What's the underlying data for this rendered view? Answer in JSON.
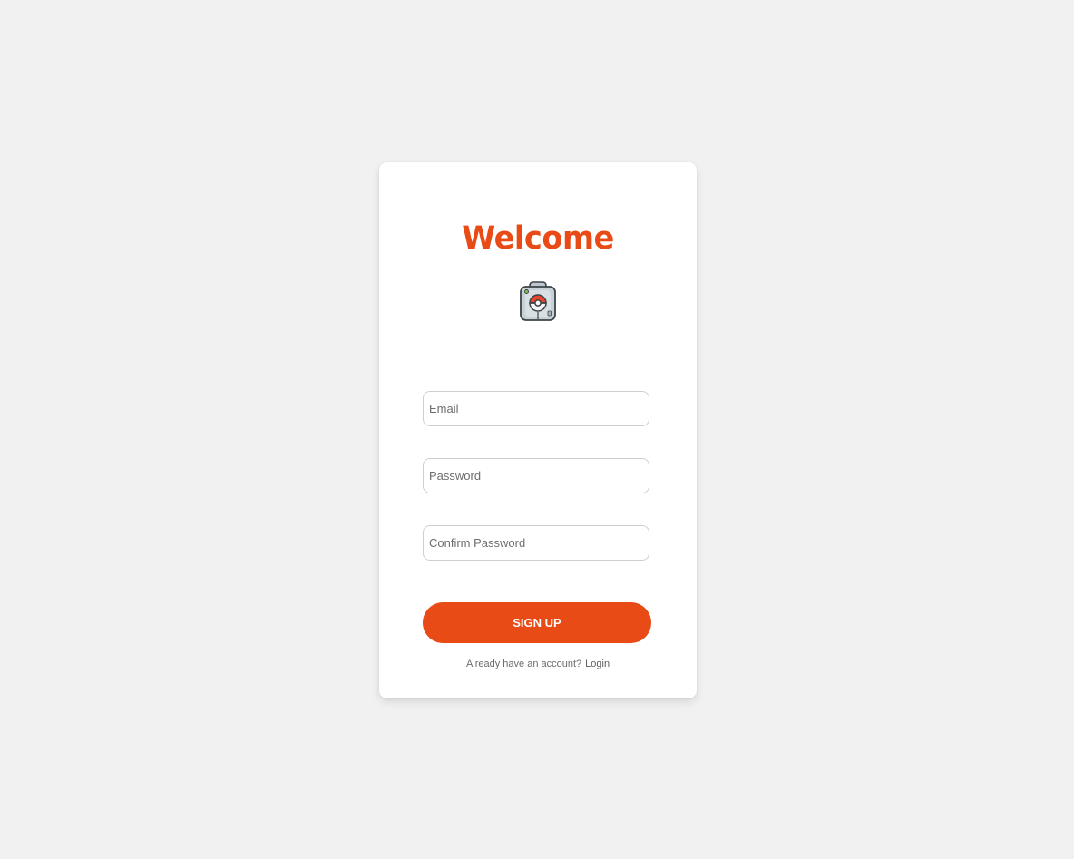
{
  "card": {
    "title": "Welcome",
    "logo_icon": "pokedex-pokeball-icon"
  },
  "form": {
    "email_placeholder": "Email",
    "password_placeholder": "Password",
    "confirm_placeholder": "Confirm Password",
    "email_value": "",
    "password_value": "",
    "confirm_value": "",
    "submit_label": "SIGN UP"
  },
  "footer": {
    "prompt": "Already have an account?",
    "link_label": "Login"
  },
  "colors": {
    "background": "#f1f1f1",
    "card": "#ffffff",
    "accent": "#e84b16",
    "input_border": "#cfcfcf"
  }
}
